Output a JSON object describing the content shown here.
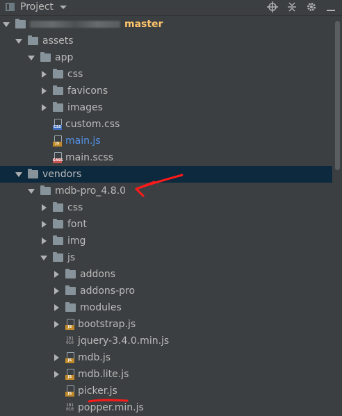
{
  "panel": {
    "title": "Project",
    "icons": [
      "project-icon",
      "dropdown-icon",
      "locate-icon",
      "collapse-all-icon",
      "gear-icon",
      "hide-icon"
    ]
  },
  "tree": [
    {
      "name": "root-folder",
      "label": "",
      "branch": "master",
      "kind": "root",
      "level": 0,
      "expanded": true
    },
    {
      "name": "folder-assets",
      "label": "assets",
      "kind": "folder",
      "level": 1,
      "expanded": true
    },
    {
      "name": "folder-app",
      "label": "app",
      "kind": "folder",
      "level": 2,
      "expanded": true
    },
    {
      "name": "folder-app-css",
      "label": "css",
      "kind": "folder",
      "level": 3,
      "expanded": false
    },
    {
      "name": "folder-favicons",
      "label": "favicons",
      "kind": "folder",
      "level": 3,
      "expanded": false
    },
    {
      "name": "folder-images",
      "label": "images",
      "kind": "folder",
      "level": 3,
      "expanded": false
    },
    {
      "name": "file-custom-css",
      "label": "custom.css",
      "kind": "css",
      "level": 3,
      "iconText": "CSS"
    },
    {
      "name": "file-main-js",
      "label": "main.js",
      "kind": "js-modified",
      "level": 3,
      "iconText": "JS"
    },
    {
      "name": "file-main-scss",
      "label": "main.scss",
      "kind": "sass",
      "level": 3,
      "iconText": "SASS"
    },
    {
      "name": "folder-vendors",
      "label": "vendors",
      "kind": "folder",
      "level": 1,
      "expanded": true,
      "selected": true
    },
    {
      "name": "folder-mdb-pro",
      "label": "mdb-pro_4.8.0",
      "kind": "folder",
      "level": 2,
      "expanded": true
    },
    {
      "name": "folder-mdb-css",
      "label": "css",
      "kind": "folder",
      "level": 3,
      "expanded": false
    },
    {
      "name": "folder-font",
      "label": "font",
      "kind": "folder",
      "level": 3,
      "expanded": false
    },
    {
      "name": "folder-img",
      "label": "img",
      "kind": "folder",
      "level": 3,
      "expanded": false
    },
    {
      "name": "folder-js",
      "label": "js",
      "kind": "folder",
      "level": 3,
      "expanded": true
    },
    {
      "name": "folder-addons",
      "label": "addons",
      "kind": "folder",
      "level": 4,
      "expanded": false
    },
    {
      "name": "folder-addons-pro",
      "label": "addons-pro",
      "kind": "folder",
      "level": 4,
      "expanded": false
    },
    {
      "name": "folder-modules",
      "label": "modules",
      "kind": "folder",
      "level": 4,
      "expanded": false
    },
    {
      "name": "file-bootstrap-js",
      "label": "bootstrap.js",
      "kind": "js",
      "level": 4,
      "expandable": true,
      "iconText": "JS"
    },
    {
      "name": "file-jquery-min-js",
      "label": "jquery-3.4.0.min.js",
      "kind": "min",
      "level": 4
    },
    {
      "name": "file-mdb-js",
      "label": "mdb.js",
      "kind": "js",
      "level": 4,
      "expandable": true,
      "iconText": "JS"
    },
    {
      "name": "file-mdb-lite-js",
      "label": "mdb.lite.js",
      "kind": "js",
      "level": 4,
      "expandable": true,
      "iconText": "JS"
    },
    {
      "name": "file-picker-js",
      "label": "picker.js",
      "kind": "js",
      "level": 4,
      "iconText": "JS"
    },
    {
      "name": "file-popper-min-js",
      "label": "popper.min.js",
      "kind": "min",
      "level": 4
    }
  ],
  "colors": {
    "background": "#3c3f41",
    "selection": "#0d293e",
    "text": "#bbbbbb",
    "modifiedFile": "#5394ec",
    "branch": "#ffc66d",
    "annotation": "#ff0000"
  }
}
